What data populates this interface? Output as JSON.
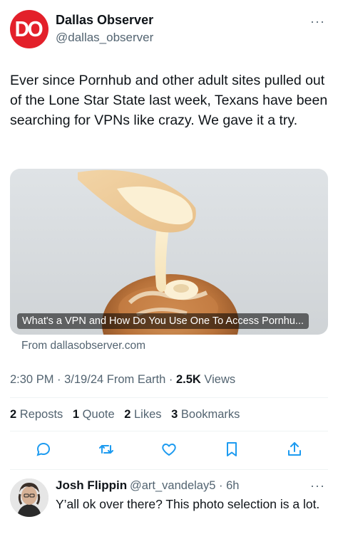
{
  "author": {
    "logo_text": "DO",
    "name": "Dallas Observer",
    "handle": "@dallas_observer",
    "more": "···"
  },
  "tweet": {
    "text": "Ever since Pornhub and other adult sites pulled out of the Lone Star State last week, Texans have been searching for VPNs like crazy. We gave it a try."
  },
  "card": {
    "title": "What's a VPN and How Do You Use One To Access Pornhu...",
    "source": "From dallasobserver.com"
  },
  "meta": {
    "time": "2:30 PM",
    "sep1": " · ",
    "date": "3/19/24",
    "from": " From Earth",
    "sep2": " · ",
    "views_count": "2.5K",
    "views_label": " Views"
  },
  "stats": {
    "reposts_count": "2",
    "reposts_label": " Reposts",
    "quote_count": "1",
    "quote_label": " Quote",
    "likes_count": "2",
    "likes_label": " Likes",
    "bookmarks_count": "3",
    "bookmarks_label": " Bookmarks"
  },
  "actions": [
    "reply-icon",
    "repost-icon",
    "like-icon",
    "bookmark-icon",
    "share-icon"
  ],
  "reply": {
    "name": "Josh Flippin",
    "handle": "@art_vandelay5",
    "sep": " · ",
    "time": "6h",
    "more": "···",
    "text": "Y’all ok over there? This photo selection is a lot."
  },
  "colors": {
    "brand_red": "#e3202a",
    "secondary_text": "#536471",
    "primary_text": "#0f1419",
    "action_icon": "#1d9bf0"
  }
}
